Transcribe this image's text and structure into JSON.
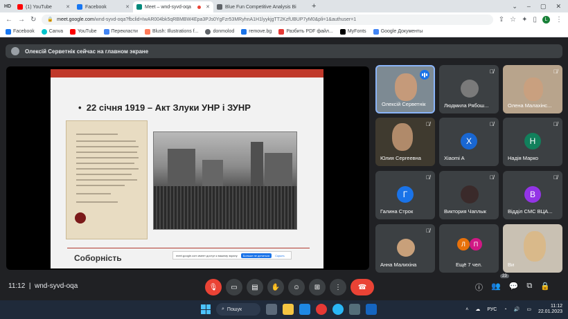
{
  "browser": {
    "tabs": [
      {
        "label": "HD",
        "color": "#3c4043"
      },
      {
        "label": "(1) YouTube",
        "color": "#ff0000"
      },
      {
        "label": "Facebook",
        "color": "#1877f2"
      },
      {
        "label": "Meet – wnd-syvd-oqa",
        "color": "#00897b",
        "active": true
      },
      {
        "label": "Blue Fun Competitive Analysis Bi",
        "color": "#5f6368"
      }
    ],
    "url_host": "meet.google.com",
    "url_path": "/wnd-syvd-oqa?fbclid=IwAR004bk5qRBMBW4Epa3PJs0YgFzr53MRyhnA1H1lyykjgTT2KzfUBUP7yM0&pli=1&authuser=1",
    "profile_letter": "L",
    "bookmarks": [
      {
        "label": "Facebook",
        "color": "#1877f2"
      },
      {
        "label": "Canva",
        "color": "#00c4cc"
      },
      {
        "label": "YouTube",
        "color": "#ff0000"
      },
      {
        "label": "Перекласти",
        "color": "#4285f4"
      },
      {
        "label": "Blush: Illustrations f...",
        "color": "#ff7a59"
      },
      {
        "label": "donmolod",
        "color": "#5f6368"
      },
      {
        "label": "remove.bg",
        "color": "#1a73e8"
      },
      {
        "label": "Разбить PDF файл...",
        "color": "#e53935"
      },
      {
        "label": "MyFonts",
        "color": "#000000"
      },
      {
        "label": "Google Документы",
        "color": "#4285f4"
      }
    ]
  },
  "meet": {
    "presenter_banner": "Олексій Серветнік сейчас на главном экране",
    "slide": {
      "title": "22 січня 1919 – Акт Злуки УНР і ЗУНР",
      "footer": "Соборність",
      "share_notice": "meet.google.com имеет доступ к вашему экрану",
      "share_stop": "Больше не делиться",
      "share_hide": "Скрыть"
    },
    "participants": [
      {
        "name": "Олексій Серветнік",
        "type": "video",
        "speaking": true
      },
      {
        "name": "Людмила Рябош...",
        "type": "photo",
        "avatar_color": "#7a7a7a"
      },
      {
        "name": "Олена Малахінс...",
        "type": "video"
      },
      {
        "name": "Юлия Сергеевна",
        "type": "video"
      },
      {
        "name": "Xiaomi A",
        "type": "letter",
        "letter": "X",
        "avatar_color": "#1967d2"
      },
      {
        "name": "Надія Марко",
        "type": "letter",
        "letter": "Н",
        "avatar_color": "#12805c"
      },
      {
        "name": "Галина Строк",
        "type": "letter",
        "letter": "Г",
        "avatar_color": "#1a73e8"
      },
      {
        "name": "Виктория Чаплык",
        "type": "photo",
        "avatar_color": "#3a2a2a"
      },
      {
        "name": "Відділ СМС ВЦА...",
        "type": "letter",
        "letter": "В",
        "avatar_color": "#9334e6"
      },
      {
        "name": "Анна Малихіна",
        "type": "photo",
        "avatar_color": "#c8a07a"
      },
      {
        "name": "Ещё 7 чел.",
        "type": "others",
        "letters": [
          "Л",
          "П"
        ],
        "colors": [
          "#e8710a",
          "#d01884"
        ]
      },
      {
        "name": "Ви",
        "type": "video"
      }
    ],
    "time": "11:12",
    "meeting_code": "wnd-syvd-oqa",
    "people_count": "23"
  },
  "taskbar": {
    "search_label": "Пошук",
    "lang": "РУС",
    "time": "11:12",
    "date": "22.01.2023"
  }
}
